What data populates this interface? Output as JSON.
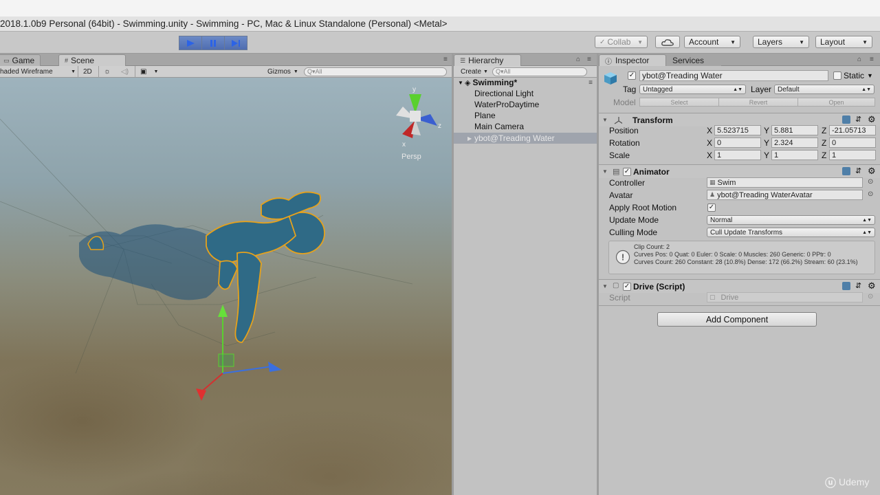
{
  "window": {
    "title": "2018.1.0b9 Personal (64bit) - Swimming.unity - Swimming - PC, Mac & Linux Standalone (Personal) <Metal>"
  },
  "toolbar": {
    "collab": "Collab",
    "account": "Account",
    "layers": "Layers",
    "layout": "Layout"
  },
  "scene_panel": {
    "tabs": [
      {
        "label": "Game"
      },
      {
        "label": "Scene"
      }
    ],
    "draw_mode": "haded Wireframe",
    "mode_2d": "2D",
    "gizmos": "Gizmos",
    "search_placeholder": "Q▾All",
    "gizmo": {
      "y": "y",
      "z": "z",
      "x": "x",
      "projection": "Persp"
    }
  },
  "hierarchy": {
    "tab": "Hierarchy",
    "create": "Create",
    "search_placeholder": "Q▾All",
    "scene_name": "Swimming*",
    "items": [
      {
        "label": "Directional Light"
      },
      {
        "label": "WaterProDaytime"
      },
      {
        "label": "Plane"
      },
      {
        "label": "Main Camera"
      },
      {
        "label": "ybot@Treading Water"
      }
    ]
  },
  "inspector": {
    "tabs": [
      {
        "label": "Inspector"
      },
      {
        "label": "Services"
      }
    ],
    "object_name": "ybot@Treading Water",
    "static_label": "Static",
    "tag_label": "Tag",
    "tag_value": "Untagged",
    "layer_label": "Layer",
    "layer_value": "Default",
    "model_label": "Model",
    "model_buttons": {
      "select": "Select",
      "revert": "Revert",
      "open": "Open"
    },
    "transform": {
      "title": "Transform",
      "position_label": "Position",
      "rotation_label": "Rotation",
      "scale_label": "Scale",
      "axis_x": "X",
      "axis_y": "Y",
      "axis_z": "Z",
      "position": {
        "x": "5.523715",
        "y": "5.881",
        "z": "-21.05713"
      },
      "rotation": {
        "x": "0",
        "y": "2.324",
        "z": "0"
      },
      "scale": {
        "x": "1",
        "y": "1",
        "z": "1"
      }
    },
    "animator": {
      "title": "Animator",
      "controller_label": "Controller",
      "controller_value": "Swim",
      "avatar_label": "Avatar",
      "avatar_value": "ybot@Treading WaterAvatar",
      "apply_root_motion_label": "Apply Root Motion",
      "apply_root_motion": true,
      "update_mode_label": "Update Mode",
      "update_mode_value": "Normal",
      "culling_mode_label": "Culling Mode",
      "culling_mode_value": "Cull Update Transforms",
      "info_line1": "Clip Count: 2",
      "info_line2": "Curves Pos: 0 Quat: 0 Euler: 0 Scale: 0 Muscles: 260 Generic: 0 PPtr: 0",
      "info_line3": "Curves Count: 260 Constant: 28 (10.8%) Dense: 172 (66.2%) Stream: 60 (23.1%)"
    },
    "drive": {
      "title": "Drive (Script)",
      "script_label": "Script",
      "script_value": "Drive"
    },
    "add_component": "Add Component"
  },
  "watermark": "Udemy",
  "colors": {
    "play_blue": "#5574b8",
    "selection": "#9fa4ad",
    "character": "#2f6a86",
    "outline": "#e6a21c"
  }
}
